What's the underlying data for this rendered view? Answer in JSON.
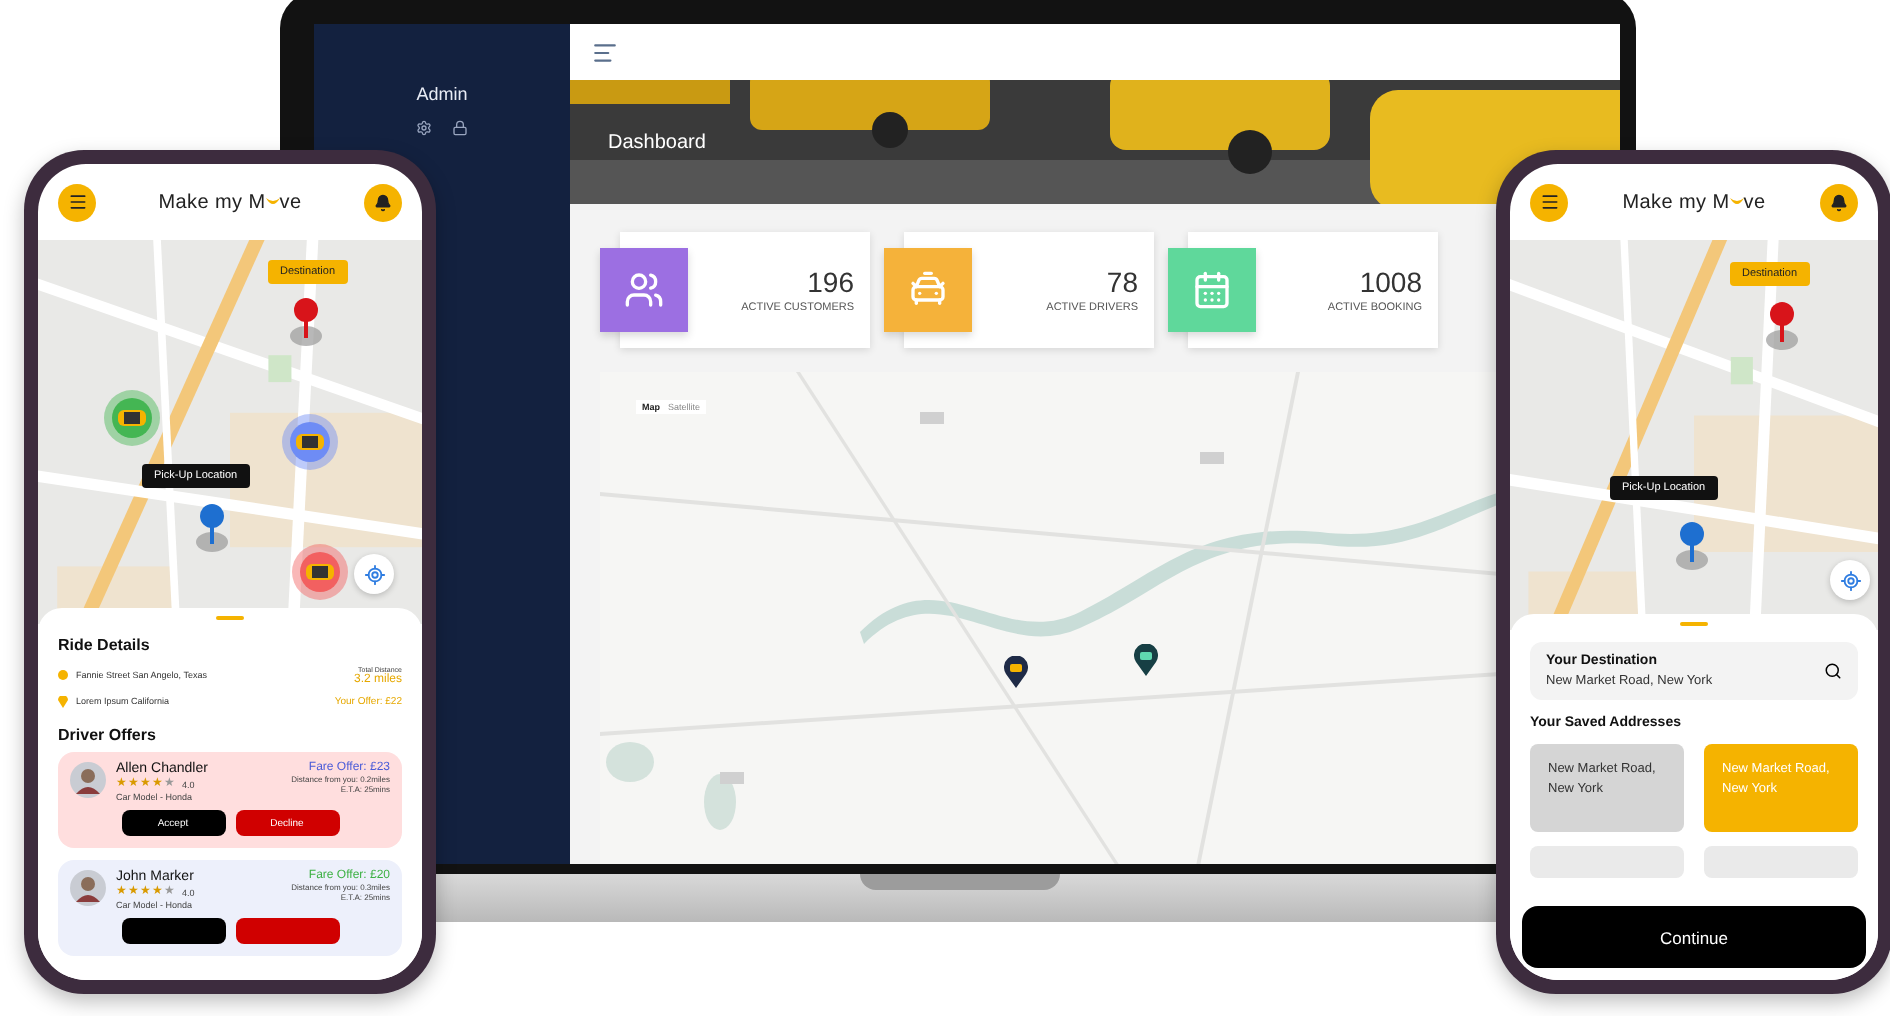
{
  "laptop": {
    "sidebar": {
      "user": "Admin"
    },
    "page_title": "Dashboard",
    "stats": [
      {
        "kind": "customers",
        "value": "196",
        "label": "ACTIVE CUSTOMERS",
        "color": "#9c6fe2"
      },
      {
        "kind": "drivers",
        "value": "78",
        "label": "ACTIVE DRIVERS",
        "color": "#f5b23a"
      },
      {
        "kind": "booking",
        "value": "1008",
        "label": "ACTIVE BOOKING",
        "color": "#5fd89b"
      }
    ],
    "map": {
      "toggle": [
        {
          "label": "Map",
          "selected": true
        },
        {
          "label": "Satellite",
          "selected": false
        }
      ],
      "markers": [
        {
          "kind": "taxi",
          "color": "#1f2b47"
        },
        {
          "kind": "car",
          "color": "#173f44"
        }
      ]
    }
  },
  "ride_phone": {
    "brand_start": "Make my M",
    "brand_end": "ve",
    "map": {
      "destination_label": "Destination",
      "pickup_label": "Pick-Up Location",
      "cars": [
        {
          "color": "#44b653"
        },
        {
          "color": "#6e8cf5"
        },
        {
          "color": "#f26060"
        }
      ]
    },
    "ride_details": {
      "title": "Ride Details",
      "from": "Fannie Street San Angelo, Texas",
      "to": "Lorem Ipsum California",
      "distance_label": "Total Distance",
      "distance": "3.2 miles",
      "offer": "Your Offer: £22"
    },
    "offers_title": "Driver Offers",
    "offers": [
      {
        "name": "Allen Chandler",
        "stars": 4,
        "rating": "4.0",
        "car": "Car Model - Honda",
        "fare": {
          "text": "Fare Offer: £23",
          "color": "#4a5bd8"
        },
        "distance": "Distance from you: 0.2miles",
        "eta": "E.T.A: 25mins",
        "color": "#ffdede",
        "actions": [
          {
            "kind": "accept",
            "label": "Accept"
          },
          {
            "kind": "decline",
            "label": "Decline"
          }
        ]
      },
      {
        "name": "John Marker",
        "stars": 4,
        "rating": "4.0",
        "car": "Car Model - Honda",
        "fare": {
          "text": "Fare Offer: £20",
          "color": "#3cb043"
        },
        "distance": "Distance from you: 0.3miles",
        "eta": "E.T.A: 25mins",
        "color": "#edf0fb",
        "actions": [
          {
            "kind": "accept"
          },
          {
            "kind": "decline"
          }
        ]
      }
    ]
  },
  "address_phone": {
    "brand_start": "Make my M",
    "brand_end": "ve",
    "map": {
      "destination_label": "Destination",
      "pickup_label": "Pick-Up Location"
    },
    "destination": {
      "label": "Your Destination",
      "value": "New Market Road, New York"
    },
    "saved_title": "Your Saved Addresses",
    "saved": [
      {
        "label": "New Market Road, New York",
        "selected": false
      },
      {
        "label": "New Market Road, New York",
        "selected": true
      },
      {
        "selected": false
      },
      {
        "selected": false
      }
    ],
    "continue": "Continue"
  }
}
